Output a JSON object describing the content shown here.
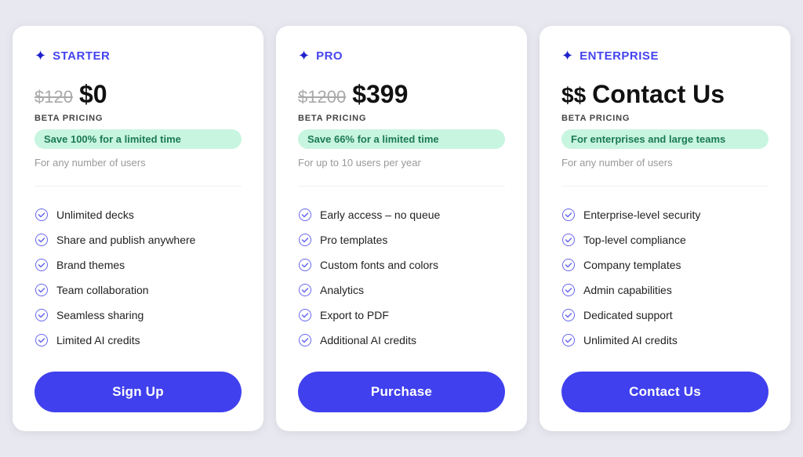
{
  "plans": [
    {
      "id": "starter",
      "name": "STARTER",
      "original_price": "$120",
      "current_price": "$0",
      "beta_label": "BETA PRICING",
      "save_badge": "Save 100% for a limited time",
      "description": "For any number of users",
      "features": [
        "Unlimited decks",
        "Share and publish anywhere",
        "Brand themes",
        "Team collaboration",
        "Seamless sharing",
        "Limited AI credits"
      ],
      "cta_label": "Sign Up"
    },
    {
      "id": "pro",
      "name": "PRO",
      "original_price": "$1200",
      "current_price": "$399",
      "beta_label": "BETA PRICING",
      "save_badge": "Save 66% for a limited time",
      "description": "For up to 10 users per year",
      "features": [
        "Early access – no queue",
        "Pro templates",
        "Custom fonts and colors",
        "Analytics",
        "Export to PDF",
        "Additional AI credits"
      ],
      "cta_label": "Purchase"
    },
    {
      "id": "enterprise",
      "name": "ENTERPRISE",
      "original_price": "$$",
      "current_price": "Contact Us",
      "beta_label": "BETA PRICING",
      "save_badge": "For enterprises and large teams",
      "description": "For any number of users",
      "features": [
        "Enterprise-level security",
        "Top-level compliance",
        "Company templates",
        "Admin capabilities",
        "Dedicated support",
        "Unlimited AI credits"
      ],
      "cta_label": "Contact Us"
    }
  ]
}
